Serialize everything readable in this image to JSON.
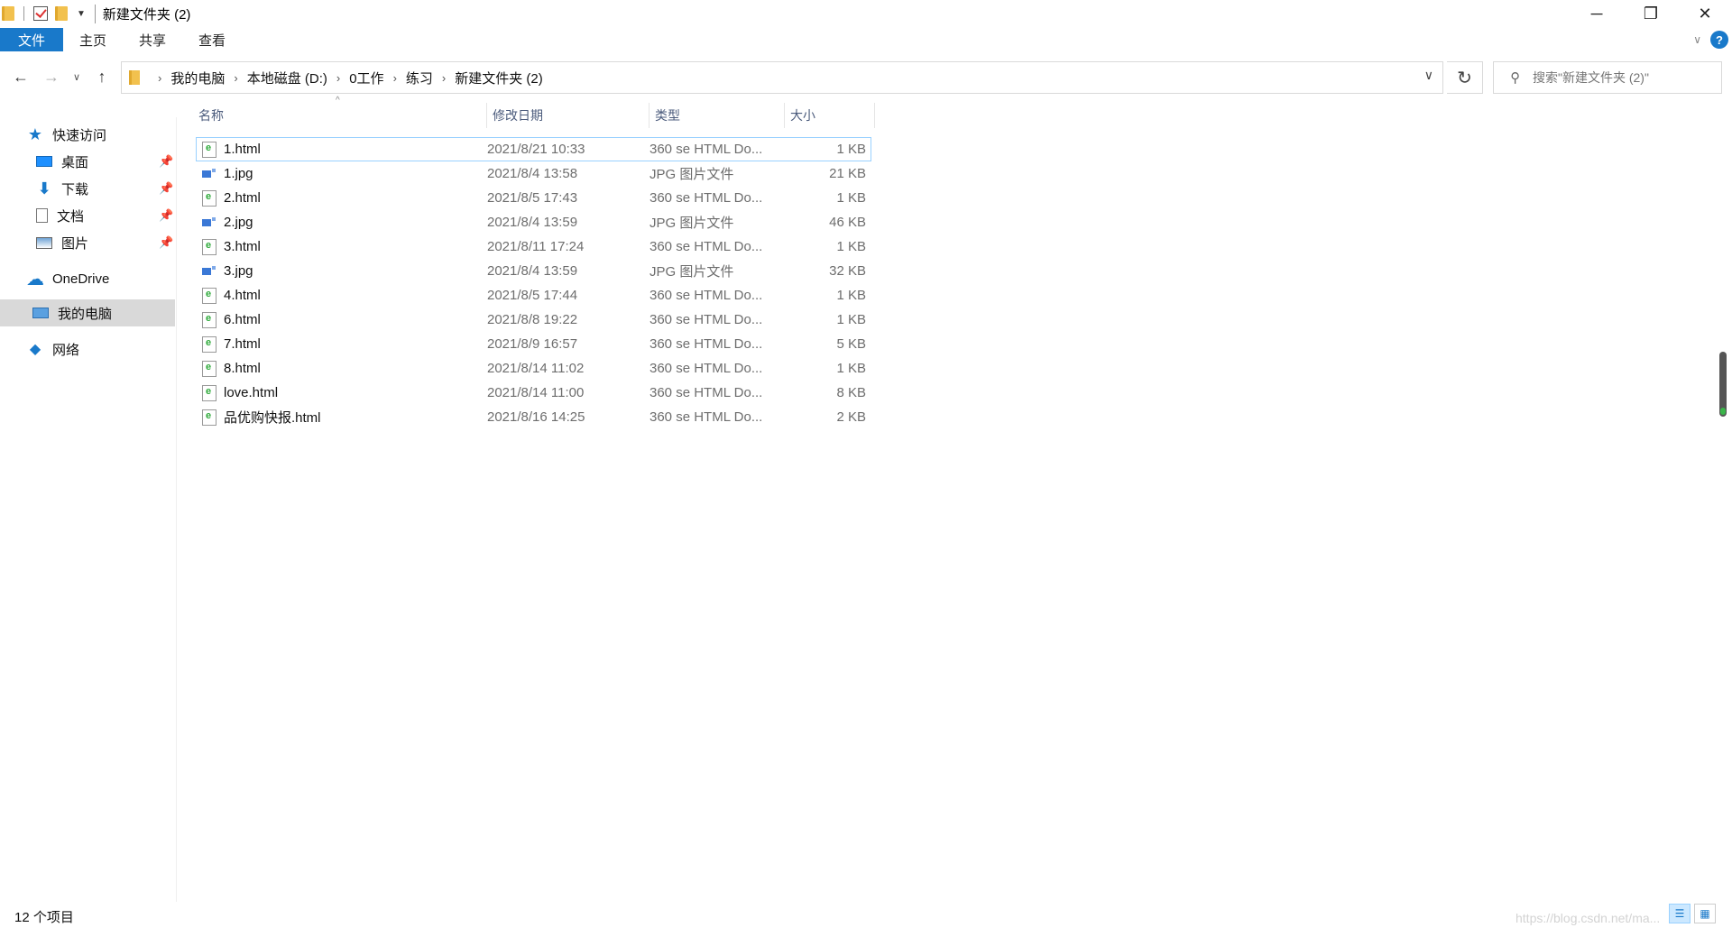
{
  "window": {
    "title": "新建文件夹 (2)",
    "controls": {
      "minimize": "─",
      "restore": "❐",
      "close": "✕"
    }
  },
  "ribbon": {
    "tabs": [
      "文件",
      "主页",
      "共享",
      "查看"
    ],
    "help": "?"
  },
  "nav": {
    "back": "←",
    "forward": "→",
    "recent": "∨",
    "up": "↑",
    "breadcrumb": [
      "我的电脑",
      "本地磁盘 (D:)",
      "0工作",
      "练习",
      "新建文件夹 (2)"
    ],
    "breadcrumb_separator": "›",
    "dropdown": "∨",
    "refresh": "↻"
  },
  "search": {
    "placeholder": "搜索\"新建文件夹 (2)\"",
    "icon": "⚲"
  },
  "sidebar": {
    "items": [
      {
        "label": "快速访问",
        "icon": "star-icon",
        "glyph": "★"
      },
      {
        "label": "桌面",
        "icon": "desktop-icon",
        "pin": "📌"
      },
      {
        "label": "下载",
        "icon": "download-icon",
        "glyph": "⬇",
        "pin": "📌"
      },
      {
        "label": "文档",
        "icon": "document-icon",
        "pin": "📌"
      },
      {
        "label": "图片",
        "icon": "pictures-icon",
        "pin": "📌"
      },
      {
        "label": "OneDrive",
        "icon": "cloud-icon",
        "glyph": "☁"
      },
      {
        "label": "我的电脑",
        "icon": "computer-icon"
      },
      {
        "label": "网络",
        "icon": "network-icon",
        "glyph": "◆"
      }
    ]
  },
  "columns": {
    "name": "名称",
    "date": "修改日期",
    "type": "类型",
    "size": "大小",
    "sort_caret": "^"
  },
  "files": [
    {
      "name": "1.html",
      "date": "2021/8/21 10:33",
      "type": "360 se HTML Do...",
      "size": "1 KB",
      "kind": "html"
    },
    {
      "name": "1.jpg",
      "date": "2021/8/4 13:58",
      "type": "JPG 图片文件",
      "size": "21 KB",
      "kind": "jpg"
    },
    {
      "name": "2.html",
      "date": "2021/8/5 17:43",
      "type": "360 se HTML Do...",
      "size": "1 KB",
      "kind": "html"
    },
    {
      "name": "2.jpg",
      "date": "2021/8/4 13:59",
      "type": "JPG 图片文件",
      "size": "46 KB",
      "kind": "jpg"
    },
    {
      "name": "3.html",
      "date": "2021/8/11 17:24",
      "type": "360 se HTML Do...",
      "size": "1 KB",
      "kind": "html"
    },
    {
      "name": "3.jpg",
      "date": "2021/8/4 13:59",
      "type": "JPG 图片文件",
      "size": "32 KB",
      "kind": "jpg"
    },
    {
      "name": "4.html",
      "date": "2021/8/5 17:44",
      "type": "360 se HTML Do...",
      "size": "1 KB",
      "kind": "html"
    },
    {
      "name": "6.html",
      "date": "2021/8/8 19:22",
      "type": "360 se HTML Do...",
      "size": "1 KB",
      "kind": "html"
    },
    {
      "name": "7.html",
      "date": "2021/8/9 16:57",
      "type": "360 se HTML Do...",
      "size": "5 KB",
      "kind": "html"
    },
    {
      "name": "8.html",
      "date": "2021/8/14 11:02",
      "type": "360 se HTML Do...",
      "size": "1 KB",
      "kind": "html"
    },
    {
      "name": "love.html",
      "date": "2021/8/14 11:00",
      "type": "360 se HTML Do...",
      "size": "8 KB",
      "kind": "html"
    },
    {
      "name": "品优购快报.html",
      "date": "2021/8/16 14:25",
      "type": "360 se HTML Do...",
      "size": "2 KB",
      "kind": "html"
    }
  ],
  "status": {
    "count": "12 个项目",
    "watermark": "https://blog.csdn.net/ma..."
  },
  "colors": {
    "accent": "#1979ca",
    "selected_bg": "#d9d9d9",
    "focus_border": "#99d1ff"
  }
}
